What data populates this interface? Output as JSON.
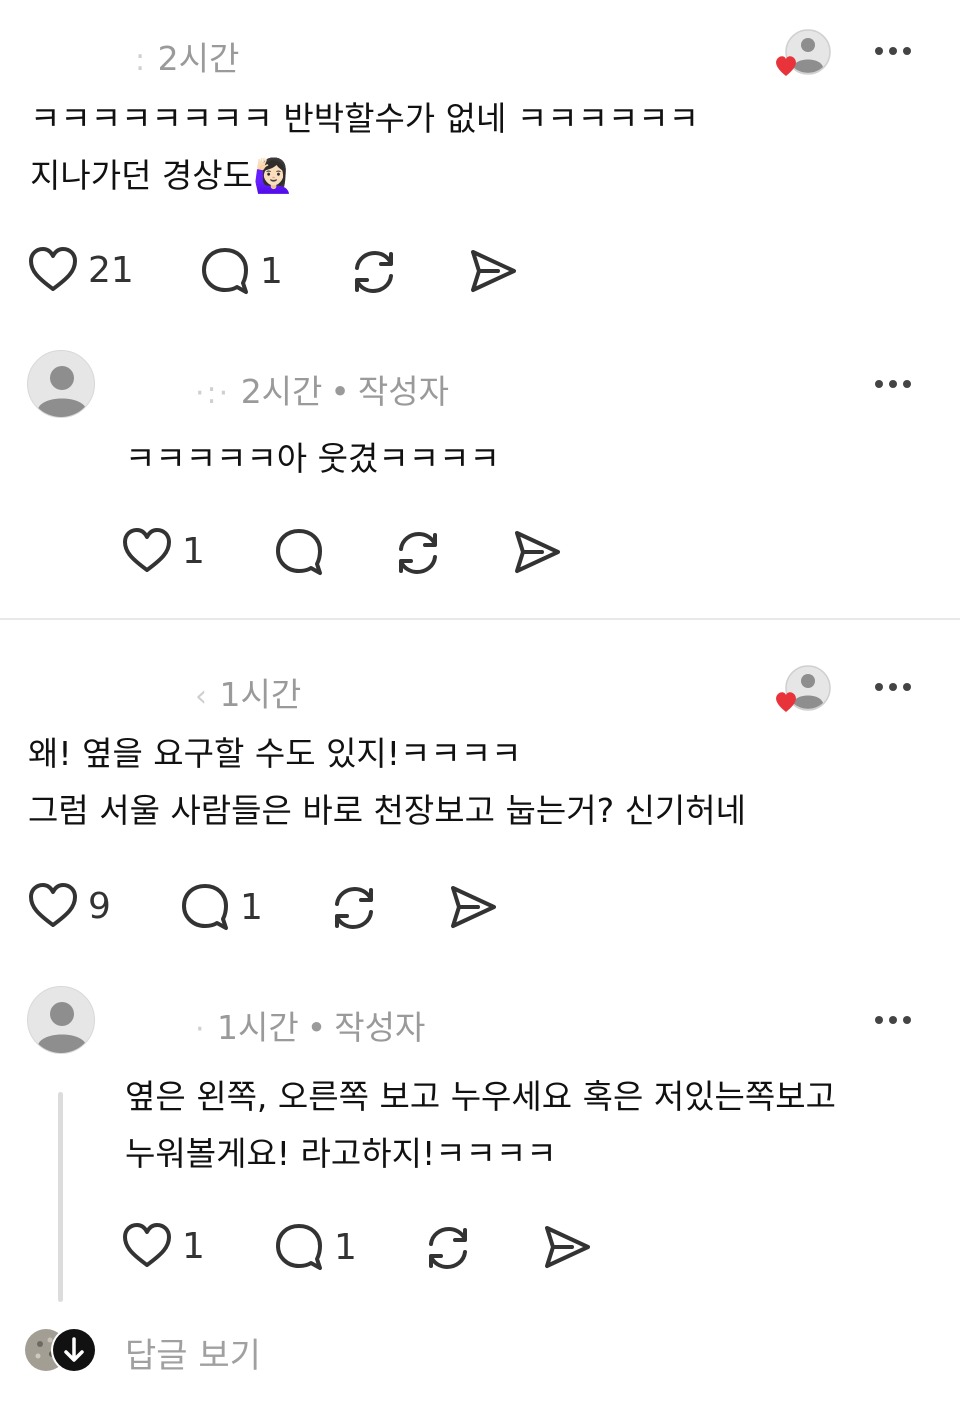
{
  "comments": [
    {
      "author_masked": ":",
      "time": "2시간",
      "lines": [
        "ㅋㅋㅋㅋㅋㅋㅋㅋ 반박할수가 없네 ㅋㅋㅋㅋㅋㅋ",
        "지나가던 경상도🙋🏻‍♀️"
      ],
      "likes": "21",
      "replies": "1"
    },
    {
      "author_masked": "·:·",
      "time": "2시간",
      "author_badge": "작성자",
      "lines": [
        "ㅋㅋㅋㅋㅋ아 웃겼ㅋㅋㅋㅋ"
      ],
      "likes": "1",
      "replies": ""
    },
    {
      "author_masked": "‹",
      "time": "1시간",
      "lines": [
        "왜! 옆을 요구할 수도 있지!ㅋㅋㅋㅋ",
        "그럼 서울 사람들은 바로 천장보고 눕는거? 신기허네"
      ],
      "likes": "9",
      "replies": "1"
    },
    {
      "author_masked": "·",
      "time": "1시간",
      "author_badge": "작성자",
      "lines": [
        "옆은 왼쪽, 오른쪽 보고 누우세요 혹은 저있는쪽보고",
        "누워볼게요! 라고하지!ㅋㅋㅋㅋ"
      ],
      "likes": "1",
      "replies": "1"
    }
  ],
  "view_replies_label": "답글 보기",
  "colors": {
    "text": "#111111",
    "meta": "#9a9a9a",
    "heart_red": "#e8333b",
    "icon": "#333333",
    "divider": "#e8e8e8"
  },
  "icons": [
    "heart-icon",
    "comment-icon",
    "repost-icon",
    "share-icon",
    "more-icon",
    "avatar-icon",
    "arrow-down-icon"
  ]
}
